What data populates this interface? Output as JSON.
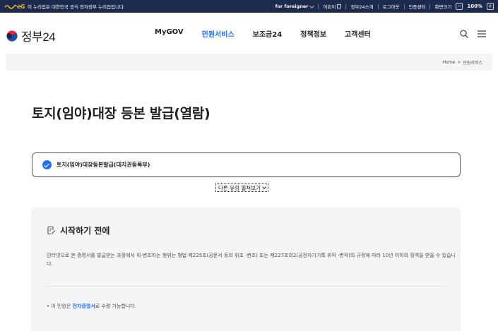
{
  "topbar": {
    "logo_text": "eG",
    "notice": "이 누리집은 대한민국 공식 전자정부 누리집입니다.",
    "foreigner": "for foreigner",
    "kids": "어린이",
    "about": "정부24소개",
    "logout": "로그아웃",
    "cert_center": "인증센터",
    "screen_size": "화면크기",
    "zoom_minus": "−",
    "zoom_value": "100%",
    "zoom_plus": "+"
  },
  "header": {
    "brand": "정부24",
    "nav": [
      {
        "label": "MyGOV",
        "active": false
      },
      {
        "label": "민원서비스",
        "active": true
      },
      {
        "label": "보조금24",
        "active": false
      },
      {
        "label": "정책정보",
        "active": false
      },
      {
        "label": "고객센터",
        "active": false
      }
    ],
    "accent_color": "#256ef4"
  },
  "breadcrumb": {
    "home": "Home",
    "separator": ">",
    "current": "민원서비스"
  },
  "page": {
    "title": "토지(임야)대장 등본 발급(열람)",
    "selected_option": "토지(임야)대장등본발급(대지권등록부)",
    "more_types": "다른 유형 펼쳐보기"
  },
  "info": {
    "title": "시작하기 전에",
    "description": "인터넷으로 본 증명서를 발급받는 과정에서 위·변조하는 행위는 형법 제225조(공문서 등의 위조 ·변조) 또는 제227조의2(공전자기기록 위작 ·변작)의 규정에 따라 10년 이하의 징역을 받을 수 있습니다.",
    "note_prefix": "• 이 민원은 ",
    "note_highlight": "전자증명서",
    "note_suffix": "로 수령 가능합니다."
  }
}
